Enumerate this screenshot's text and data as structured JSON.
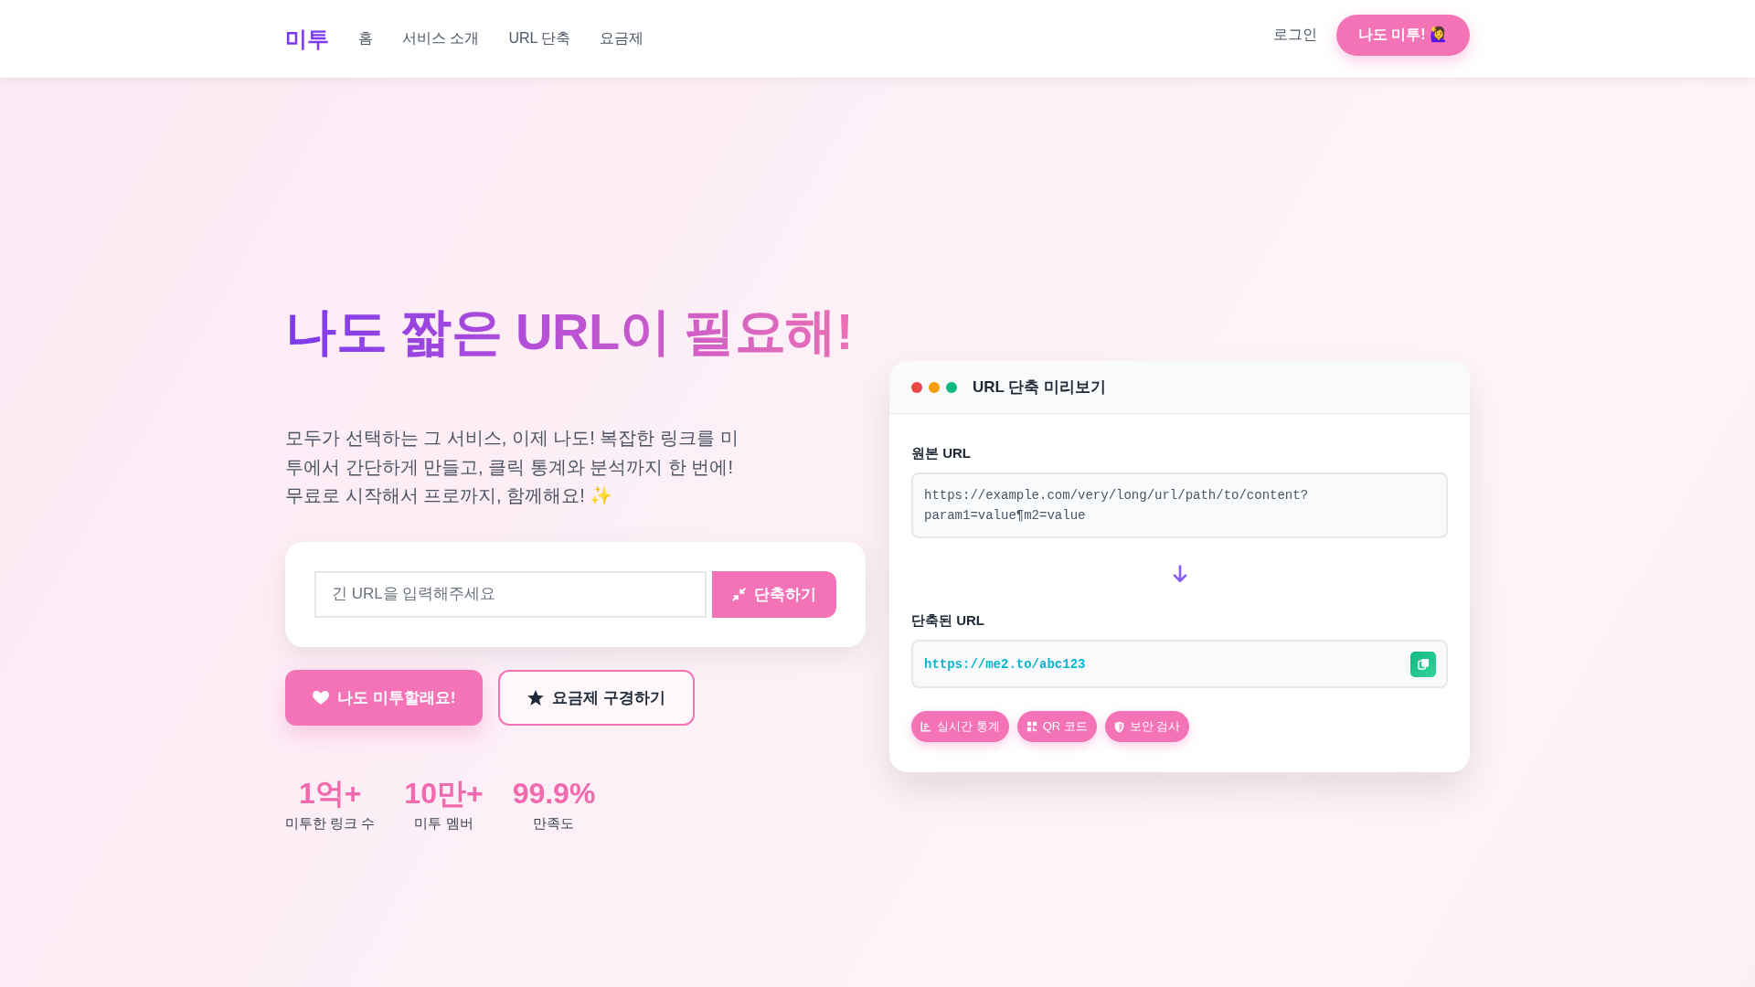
{
  "nav": {
    "logo": "미투",
    "links": [
      "홈",
      "서비스 소개",
      "URL 단축",
      "요금제"
    ],
    "login": "로그인",
    "cta": "나도 미투! 🙋‍♀️"
  },
  "hero": {
    "title": "나도 짧은 URL이 필요해!",
    "description": "모두가 선택하는 그 서비스, 이제 나도! 복잡한 링크를 미투에서 간단하게 만들고, 클릭 통계와 분석까지 한 번에! 무료로 시작해서 프로까지, 함께해요! ✨",
    "shorten_form": {
      "placeholder": "긴 URL을 입력해주세요",
      "button": "단축하기"
    },
    "buttons": [
      {
        "label": "나도 미투할래요!",
        "kind": "primary"
      },
      {
        "label": "요금제 구경하기",
        "kind": "outline"
      }
    ],
    "stats": [
      {
        "value": "1억+",
        "label": "미투한 링크 수"
      },
      {
        "value": "10만+",
        "label": "미투 멤버"
      },
      {
        "value": "99.9%",
        "label": "만족도"
      }
    ]
  },
  "preview": {
    "dots": [
      {
        "color": "#ef4444"
      },
      {
        "color": "#f59e0b"
      },
      {
        "color": "#10b981"
      }
    ],
    "title": "URL 단축 미리보기",
    "original_label": "원본 URL",
    "original_url": "https://example.com/very/long/url/path/to/content?param1=value¶m2=value",
    "short_label": "단축된 URL",
    "short_url": "https://me2.to/abc123",
    "features": [
      "실시간 통계",
      "QR 코드",
      "보안 검사"
    ]
  }
}
